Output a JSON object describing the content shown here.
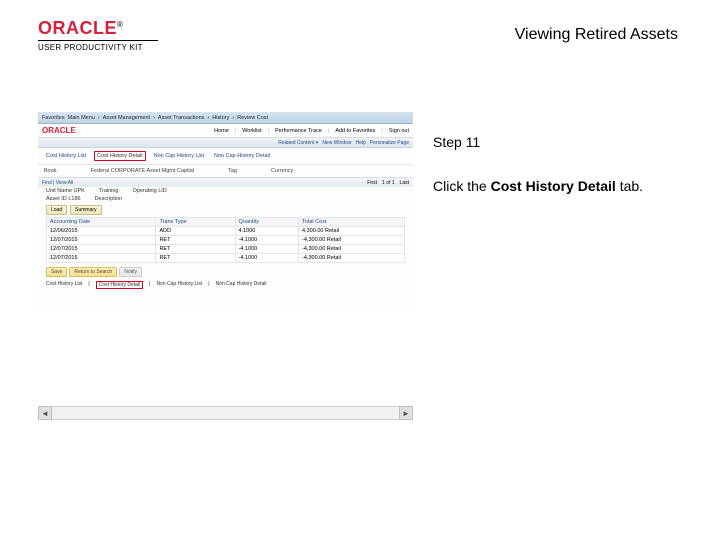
{
  "header": {
    "brand": "ORACLE",
    "tm": "®",
    "kit": "USER PRODUCTIVITY KIT",
    "title": "Viewing Retired Assets"
  },
  "instruction": {
    "step": "Step 11",
    "line_pre": "Click the ",
    "line_bold": "Cost History Detail",
    "line_post": " tab."
  },
  "screenshot": {
    "topbar": {
      "items": [
        "Favorites",
        "Main Menu",
        "Asset Management",
        "Asset Transactions",
        "History",
        "Review Cost"
      ],
      "right": [
        "Home",
        "Worklist",
        "Performance Trace",
        "Add to Favorites",
        "Sign out"
      ]
    },
    "mini_logo": "ORACLE",
    "subbar": {
      "items": [
        "Related Content ▾",
        "New Window",
        "Help",
        "Personalize Page"
      ]
    },
    "tabs": {
      "items": [
        "Cost History List",
        "Cost History Detail",
        "Non Cap History List",
        "Non Cap History Detail"
      ],
      "highlighted_index": 1
    },
    "labels": {
      "book": "Book",
      "tag": "Tag",
      "currency": "Currency"
    },
    "values": {
      "book_v": "…",
      "book_t": "Federal CORPORATE Asset Mgmt Capital"
    },
    "findbar": {
      "left": "Find | View All",
      "first": "First",
      "range": "1 of 1",
      "last": "Last"
    },
    "kv": {
      "unit_l": "Unit Name",
      "unit_v": "UPK",
      "unit_t": "Training",
      "asset_l": "Asset ID",
      "asset_v": "L186",
      "oper_l": "Operating",
      "oper_v": "LID",
      "desc_l": "Description"
    },
    "buttons": {
      "load": "Load",
      "summary": "Summary"
    },
    "table": {
      "headers": [
        "Accounting Date",
        "Trans Type",
        "Quantity",
        "Total Cost"
      ],
      "rows": [
        [
          "12/06/2015",
          "ADD",
          "4.1000",
          "4,300.00 Retail"
        ],
        [
          "12/07/2015",
          "RET",
          "-4.1000",
          "-4,300.00 Retail"
        ],
        [
          "12/07/2015",
          "RET",
          "-4.1000",
          "-4,300.00 Retail"
        ],
        [
          "12/07/2015",
          "RET",
          "-4.1000",
          "-4,300.00 Retail"
        ]
      ]
    },
    "tabstrip2": {
      "items": [
        "Save",
        "Return to Search",
        "Notify"
      ]
    },
    "bottomTabs": {
      "items": [
        "Cost History List",
        "Cost History Detail",
        "Non Cap History List",
        "Non Cap History Detail"
      ],
      "highlighted_index": 1
    }
  }
}
